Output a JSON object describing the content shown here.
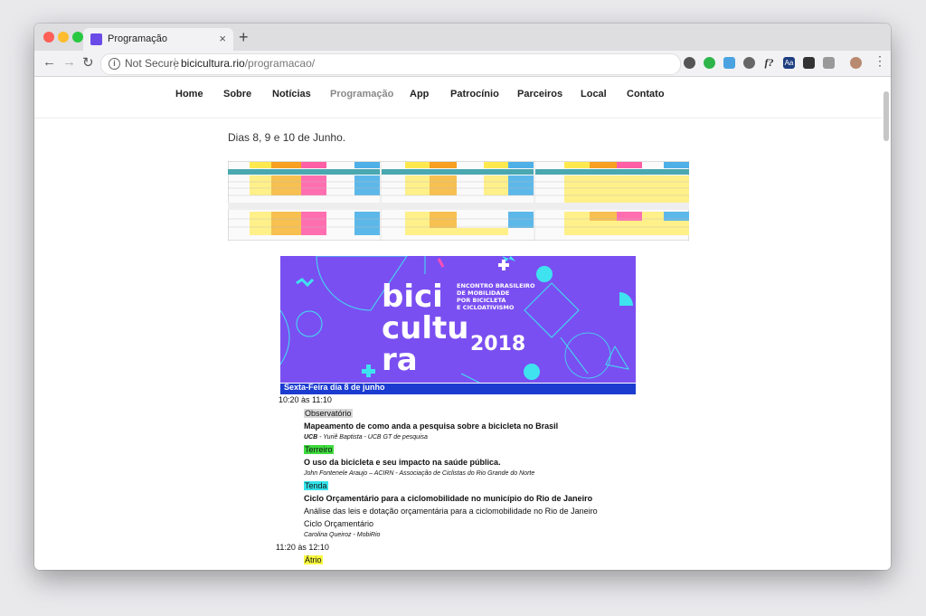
{
  "browser": {
    "tab_title": "Programação",
    "tab_close": "×",
    "new_tab": "+",
    "not_secure": "Not Secure",
    "url_host": "bicicultura.rio",
    "url_path": "/programacao/",
    "extension_labels": [
      "f?",
      "Aa"
    ]
  },
  "nav": {
    "items": [
      "Home",
      "Sobre",
      "Notícias",
      "Programação",
      "App",
      "Patrocínio",
      "Parceiros",
      "Local",
      "Contato"
    ],
    "active": "Programação"
  },
  "page": {
    "days_text": "Dias 8, 9 e 10 de Junho."
  },
  "banner": {
    "logo_lines": [
      "bici",
      "cultu",
      "ra"
    ],
    "year": "2018",
    "subtitle_lines": [
      "ENCONTRO BRASILEIRO",
      "DE MOBILIDADE",
      "POR BICICLETA",
      "E CICLOATIVISMO"
    ]
  },
  "program": {
    "day_heading": "Sexta-Feira dia 8 de junho",
    "slot1": {
      "time": "10:20 às 11:10",
      "room1": {
        "name": "Observatório",
        "title": "Mapeamento de como anda a pesquisa sobre a bicicleta no Brasil",
        "org": "UCB",
        "speaker": " - Yuriê Baptista - UCB GT de pesquisa"
      },
      "room2": {
        "name": "Terreiro",
        "title": "O uso da bicicleta e seu impacto na saúde pública.",
        "speaker": "John Fontenele Araujo – ACIRN - Associação de Ciclistas do Rio Grande do Norte"
      },
      "room3": {
        "name": "Tenda",
        "title": "Ciclo Orçamentário para a ciclomobilidade no município do Rio de Janeiro",
        "desc1": "Análise das leis e dotação orçamentária para a ciclomobilidade no Rio de Janeiro",
        "desc2": "Ciclo Orçamentário",
        "speaker": "Carolina Queiroz - MobiRio"
      }
    },
    "slot2": {
      "time": "11:20 às 12:10",
      "room1": {
        "name": "Átrio"
      }
    }
  },
  "colors": {
    "banner_purple": "#7a4ff1",
    "banner_cyan": "#3fe3f0",
    "banner_pink": "#ff4fb8",
    "day_bar": "#1c3cd0"
  }
}
